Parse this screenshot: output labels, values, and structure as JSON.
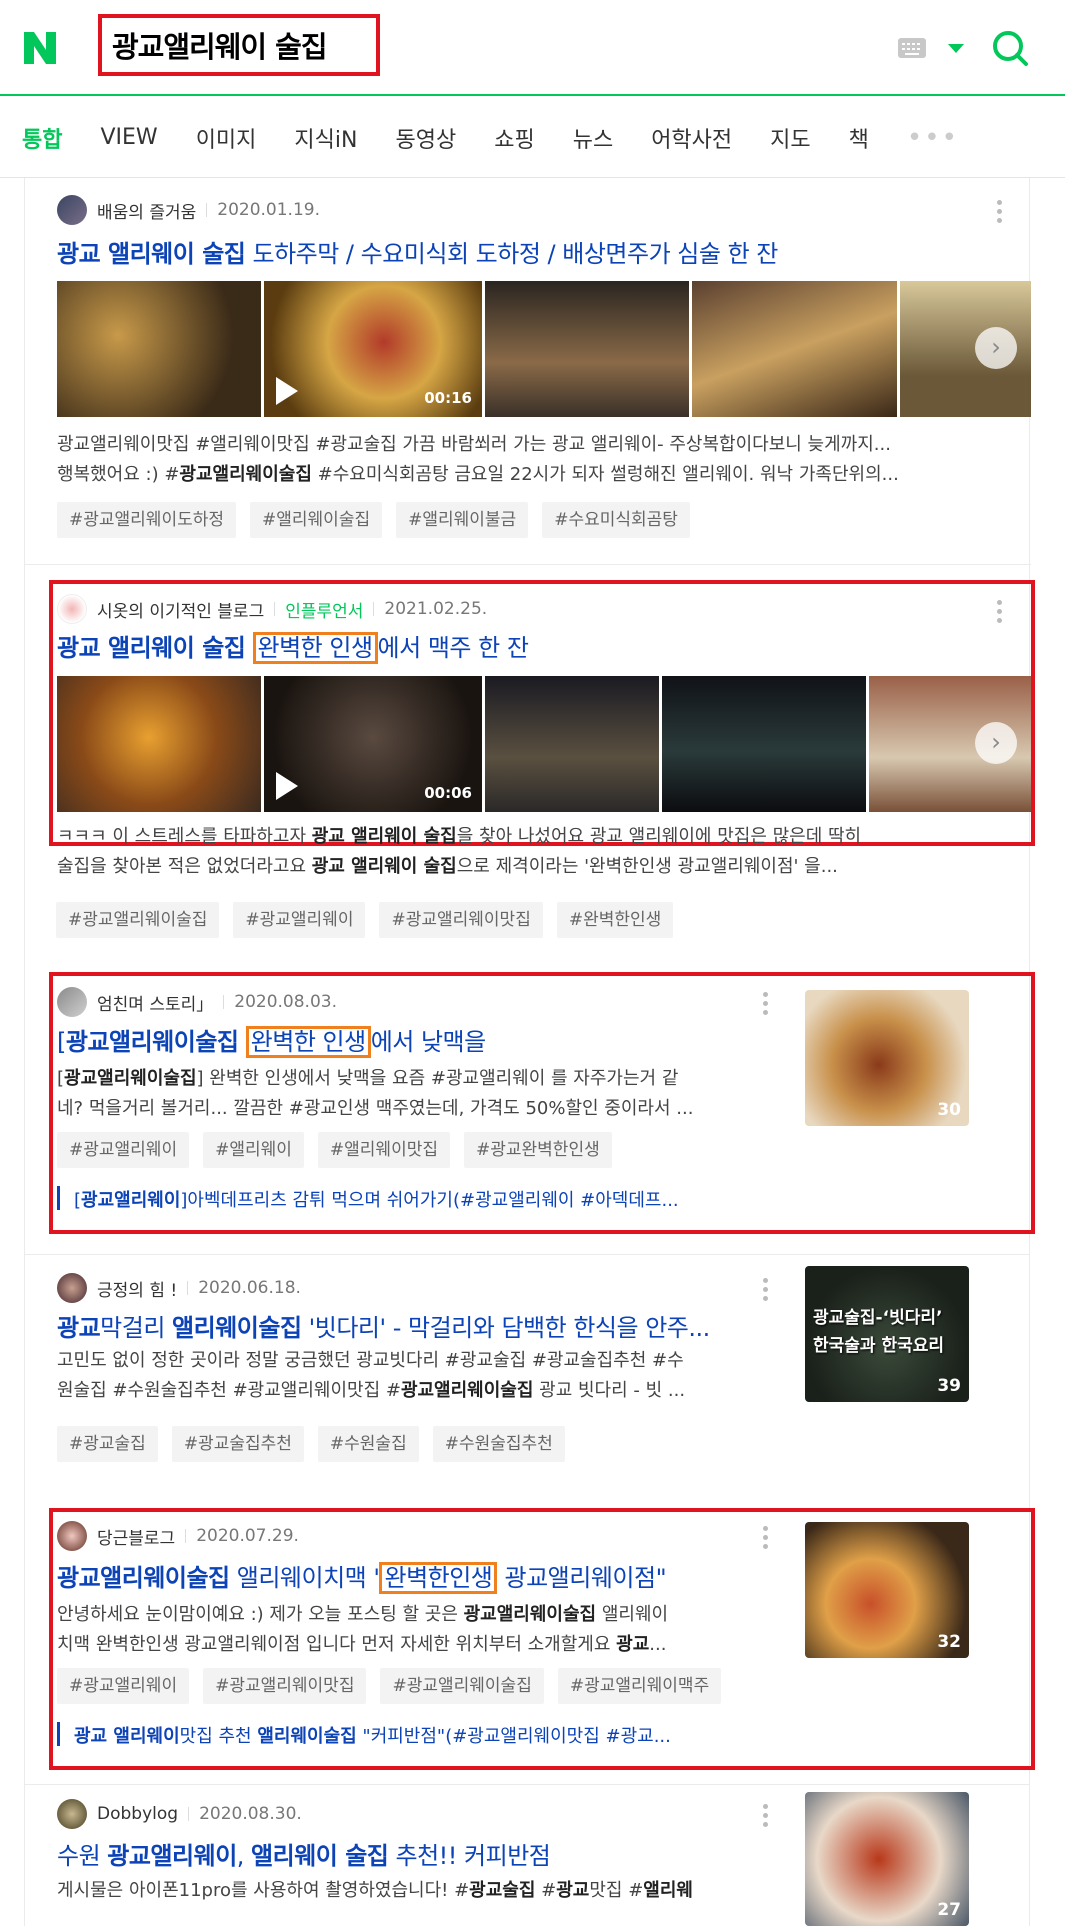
{
  "search": {
    "query": "광교앨리웨이 술집"
  },
  "tabs": [
    "통합",
    "VIEW",
    "이미지",
    "지식iN",
    "동영상",
    "쇼핑",
    "뉴스",
    "어학사전",
    "지도",
    "책",
    "•••"
  ],
  "posts": [
    {
      "author": "배움의 즐거움",
      "date": "2020.01.19.",
      "title_b": "광교 앨리웨이 술집",
      "title_rest": " 도하주막 / 수요미식회 도하정 / 배상면주가 심술 한 잔",
      "video_duration": "00:16",
      "desc1": "광교앨리웨이맛집 #앨리웨이맛집 #광교술집 가끔 바람쐬러 가는 광교 앨리웨이- 주상복합이다보니 늦게까지...",
      "desc2_a": "행복했어요 :) #",
      "desc2_b": "광교앨리웨이술집",
      "desc2_c": " #수요미식회곰탕 금요일 22시가 되자 썰렁해진 앨리웨이. 워낙 가족단위의...",
      "tags": [
        "#광교앨리웨이도하정",
        "#앨리웨이술집",
        "#앨리웨이불금",
        "#수요미식회곰탕"
      ]
    },
    {
      "author": "시옷의 이기적인 블로그",
      "badge": "인플루언서",
      "date": "2021.02.25.",
      "title_b": "광교 앨리웨이 술집",
      "title_hl": "완벽한 인생",
      "title_rest": "에서 맥주 한 잔",
      "video_duration": "00:06",
      "desc1_a": "ㅋㅋㅋ 이 스트레스를 타파하고자 ",
      "desc1_b": "광교 앨리웨이 술집",
      "desc1_c": "을 찾아 나섰어요 광교 앨리웨이에 맛집은 많은데 딱히",
      "desc2_a": "술집을 찾아본 적은 없었더라고요 ",
      "desc2_b": "광교 앨리웨이 술집",
      "desc2_c": "으로 제격이라는 '완벽한인생 광교앨리웨이점' 을...",
      "tags": [
        "#광교앨리웨이술집",
        "#광교앨리웨이",
        "#광교앨리웨이맛집",
        "#완벽한인생"
      ]
    },
    {
      "author": "엄친며 스토리」",
      "date": "2020.08.03.",
      "title_pre": "[",
      "title_b": "광교앨리웨이술집",
      "title_hl": "완벽한 인생",
      "title_rest": "에서 낮맥을",
      "desc1_a": "[",
      "desc1_b": "광교앨리웨이술집",
      "desc1_c": "] 완벽한 인생에서 낮맥을 요즘 #광교앨리웨이 를 자주가는거 같",
      "desc2": "네? 먹을거리 볼거리... 깔끔한 #광교인생 맥주였는데, 가격도 50%할인 중이라서 ...",
      "tags": [
        "#광교앨리웨이",
        "#앨리웨이",
        "#앨리웨이맛집",
        "#광교완벽한인생"
      ],
      "sub_pre": "[",
      "sub_b": "광교앨리웨이",
      "sub_rest": "]아벡데프리츠 감튀 먹으며 쉬어가기(#광교앨리웨이 #아덱데프...",
      "image_count": "30"
    },
    {
      "author": "긍정의 힘 !",
      "date": "2020.06.18.",
      "title_a": "광교",
      "title_mid": "막걸리 ",
      "title_b": "앨리웨이술집",
      "title_rest": " '빗다리' - 막걸리와 담백한 한식을 안주...",
      "desc1": "고민도 없이 정한 곳이라 정말 궁금했던 광교빗다리 #광교술집 #광교술집추천 #수",
      "desc2_a": "원술집 #수원술집추천 #광교앨리웨이맛집 #",
      "desc2_b": "광교앨리웨이술집",
      "desc2_c": " 광교 빗다리 - 빗 ...",
      "tags": [
        "#광교술집",
        "#광교술집추천",
        "#수원술집",
        "#수원술집추천"
      ],
      "thumb_line1": "광교술집-‘빗다리’",
      "thumb_line2": "한국술과 한국요리",
      "image_count": "39"
    },
    {
      "author": "당근블로그",
      "date": "2020.07.29.",
      "title_b": "광교앨리웨이술집",
      "title_mid": " 앨리웨이치맥 '",
      "title_hl": "완벽한인생",
      "title_rest": " 광교앨리웨이점\"",
      "desc1_a": "안녕하세요 눈이맘이예요 :) 제가 오늘 포스팅 할 곳은 ",
      "desc1_b": "광교앨리웨이술집",
      "desc1_c": " 앨리웨이",
      "desc2_a": "치맥 완벽한인생 광교앨리웨이점 입니다 먼저 자세한 위치부터 소개할게요 ",
      "desc2_b": "광교",
      "desc2_c": "...",
      "tags": [
        "#광교앨리웨이",
        "#광교앨리웨이맛집",
        "#광교앨리웨이술집",
        "#광교앨리웨이맥주"
      ],
      "sub_b1": "광교 앨리웨이",
      "sub_mid": "맛집 추천 ",
      "sub_b2": "앨리웨이술집",
      "sub_rest": " \"커피반점\"(#광교앨리웨이맛집 #광교...",
      "image_count": "32"
    },
    {
      "author": "Dobbylog",
      "date": "2020.08.30.",
      "title_a": "수원 ",
      "title_b": "광교앨리웨이",
      "title_mid": ", ",
      "title_b2": "앨리웨이 술집",
      "title_rest": " 추천!! 커피반점",
      "desc1_a": "게시물은 아이폰11pro를 사용하여 촬영하였습니다! #",
      "desc1_b": "광교술집",
      "desc1_c": " #",
      "desc1_d": "광교",
      "desc1_e": "맛집 #",
      "desc1_f": "앨리웨",
      "image_count": "27"
    }
  ]
}
